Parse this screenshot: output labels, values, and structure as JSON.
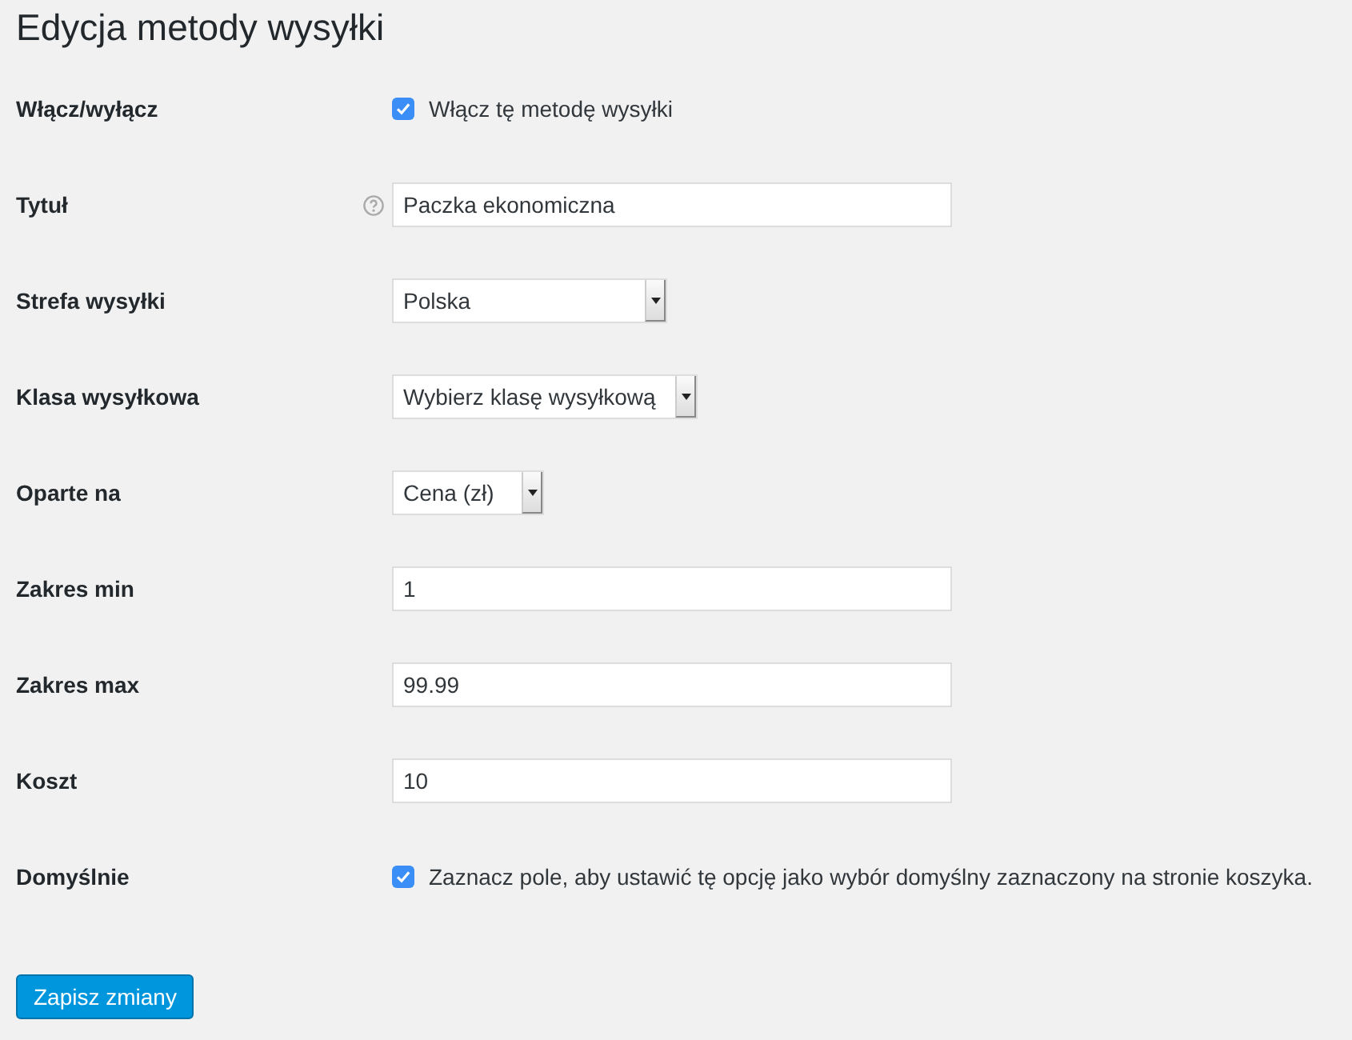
{
  "title": "Edycja metody wysyłki",
  "fields": [
    {
      "label": "Włącz/wyłącz",
      "kind": "checkbox",
      "checked": true,
      "text": "Włącz tę metodę wysyłki"
    },
    {
      "label": "Tytuł",
      "kind": "text",
      "help": true,
      "value": "Paczka ekonomiczna"
    },
    {
      "label": "Strefa wysyłki",
      "kind": "select",
      "value": "Polska"
    },
    {
      "label": "Klasa wysyłkowa",
      "kind": "select",
      "value": "Wybierz klasę wysyłkową"
    },
    {
      "label": "Oparte na",
      "kind": "select",
      "value": "Cena (zł)"
    },
    {
      "label": "Zakres min",
      "kind": "text",
      "value": "1"
    },
    {
      "label": "Zakres max",
      "kind": "text",
      "value": "99.99"
    },
    {
      "label": "Koszt",
      "kind": "text",
      "value": "10"
    },
    {
      "label": "Domyślnie",
      "kind": "checkbox",
      "checked": true,
      "text": "Zaznacz pole, aby ustawić tę opcję jako wybór domyślny zaznaczony na stronie koszyka."
    }
  ],
  "save_button": "Zapisz zmiany"
}
